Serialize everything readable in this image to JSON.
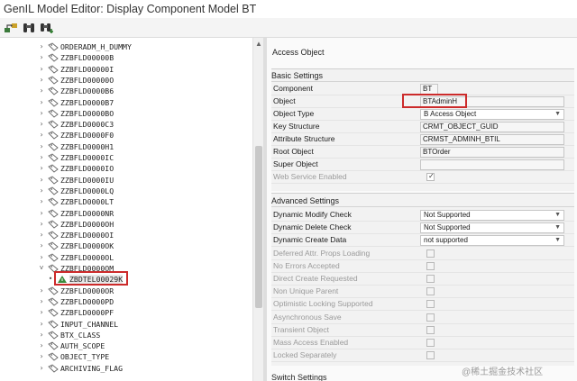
{
  "window": {
    "title": "GenIL Model Editor: Display Component Model BT"
  },
  "toolbar": {
    "buttons": [
      "hierarchy-icon",
      "binoculars-icon",
      "find-next-icon"
    ]
  },
  "tree": {
    "items": [
      {
        "label": "ORDERADM_H_DUMMY",
        "expander": "›"
      },
      {
        "label": "ZZBFLD00000B",
        "expander": "›"
      },
      {
        "label": "ZZBFLD00000I",
        "expander": "›"
      },
      {
        "label": "ZZBFLD00000O",
        "expander": "›"
      },
      {
        "label": "ZZBFLD0000B6",
        "expander": "›"
      },
      {
        "label": "ZZBFLD0000B7",
        "expander": "›"
      },
      {
        "label": "ZZBFLD0000BO",
        "expander": "›"
      },
      {
        "label": "ZZBFLD0000C3",
        "expander": "›"
      },
      {
        "label": "ZZBFLD0000F0",
        "expander": "›"
      },
      {
        "label": "ZZBFLD0000H1",
        "expander": "›"
      },
      {
        "label": "ZZBFLD0000IC",
        "expander": "›"
      },
      {
        "label": "ZZBFLD0000IO",
        "expander": "›"
      },
      {
        "label": "ZZBFLD0000IU",
        "expander": "›"
      },
      {
        "label": "ZZBFLD0000LQ",
        "expander": "›"
      },
      {
        "label": "ZZBFLD0000LT",
        "expander": "›"
      },
      {
        "label": "ZZBFLD0000NR",
        "expander": "›"
      },
      {
        "label": "ZZBFLD0000OH",
        "expander": "›"
      },
      {
        "label": "ZZBFLD0000OI",
        "expander": "›"
      },
      {
        "label": "ZZBFLD0000OK",
        "expander": "›"
      },
      {
        "label": "ZZBFLD0000OL",
        "expander": "›"
      },
      {
        "label": "ZZBFLD0000OM",
        "expander": "˅"
      },
      {
        "label": "ZBDTEL00029K",
        "expander": "•"
      },
      {
        "label": "ZZBFLD0000OR",
        "expander": "›"
      },
      {
        "label": "ZZBFLD0000PD",
        "expander": "›"
      },
      {
        "label": "ZZBFLD0000PF",
        "expander": "›"
      },
      {
        "label": "INPUT_CHANNEL",
        "expander": "›"
      },
      {
        "label": "BTX_CLASS",
        "expander": "›"
      },
      {
        "label": "AUTH_SCOPE",
        "expander": "›"
      },
      {
        "label": "OBJECT_TYPE",
        "expander": "›"
      },
      {
        "label": "ARCHIVING_FLAG",
        "expander": "›"
      }
    ]
  },
  "panel": {
    "title": "Access Object",
    "basic": {
      "heading": "Basic Settings",
      "fields": [
        {
          "label": "Component",
          "value": "BT"
        },
        {
          "label": "Object",
          "value": "BTAdminH"
        },
        {
          "label": "Object Type",
          "value": "B Access Object"
        },
        {
          "label": "Key Structure",
          "value": "CRMT_OBJECT_GUID"
        },
        {
          "label": "Attribute Structure",
          "value": "CRMST_ADMINH_BTIL"
        },
        {
          "label": "Root Object",
          "value": "BTOrder"
        },
        {
          "label": "Super Object",
          "value": ""
        },
        {
          "label": "Web Service Enabled",
          "value": ""
        }
      ]
    },
    "advanced": {
      "heading": "Advanced Settings",
      "selects": [
        {
          "label": "Dynamic Modify Check",
          "value": "Not Supported"
        },
        {
          "label": "Dynamic Delete Check",
          "value": "Not Supported"
        },
        {
          "label": "Dynamic Create Data",
          "value": "not supported"
        }
      ],
      "checks": [
        {
          "label": "Deferred Attr. Props Loading"
        },
        {
          "label": "No Errors Accepted"
        },
        {
          "label": "Direct Create Requested"
        },
        {
          "label": "Non Unique Parent"
        },
        {
          "label": "Optimistic Locking Supported"
        },
        {
          "label": "Asynchronous Save"
        },
        {
          "label": "Transient Object"
        },
        {
          "label": "Mass Access Enabled"
        },
        {
          "label": "Locked Separately"
        }
      ]
    },
    "switch": {
      "heading": "Switch Settings"
    }
  },
  "watermark": "@稀土掘金技术社区",
  "colors": {
    "highlight": "#cc2b2b",
    "accent": "#3b6ea5"
  }
}
